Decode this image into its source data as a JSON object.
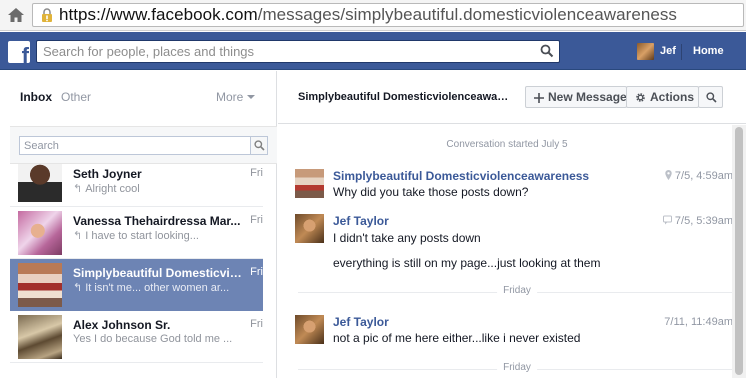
{
  "browser": {
    "url_prefix": "https://www.facebook.com",
    "url_path": "/messages/simplybeautiful.domesticviolenceawareness"
  },
  "bluebar": {
    "search_placeholder": "Search for people, places and things",
    "user_name": "Jef",
    "home_label": "Home"
  },
  "left": {
    "tab_inbox": "Inbox",
    "tab_other": "Other",
    "tab_more": "More",
    "search_placeholder": "Search",
    "threads": [
      {
        "name": "Seth Joyner",
        "time": "Fri",
        "snippet": "Alright cool",
        "replied": true,
        "selected": false,
        "avatar": "av-seth"
      },
      {
        "name": "Vanessa Thehairdressa Mar...",
        "time": "Fri",
        "snippet": "I have to start looking...",
        "replied": true,
        "selected": false,
        "avatar": "av-vanessa"
      },
      {
        "name": "Simplybeautiful Domesticvio...",
        "time": "Fri",
        "snippet": "It isn't me... other women ar...",
        "replied": true,
        "selected": true,
        "avatar": "av-simply"
      },
      {
        "name": "Alex Johnson Sr.",
        "time": "Fri",
        "snippet": "Yes I do because God told me ...",
        "replied": false,
        "selected": false,
        "avatar": "av-alex"
      }
    ]
  },
  "conversation": {
    "title": "Simplybeautiful Domesticviolenceawareness",
    "new_message_label": "New Message",
    "actions_label": "Actions",
    "started_label": "Conversation started July 5",
    "messages": [
      {
        "sender": "Simplybeautiful Domesticviolenceawareness",
        "time": "7/5, 4:59am",
        "time_icon": "location-icon",
        "lines": [
          "Why did you take those posts down?"
        ],
        "avatar": "av-simply-m"
      },
      {
        "sender": "Jef Taylor",
        "time": "7/5, 5:39am",
        "time_icon": "mobile-icon",
        "lines": [
          "I didn't take any posts down",
          "everything is still on my page...just looking at them"
        ],
        "avatar": "av-jef"
      },
      {
        "sender": "Jef Taylor",
        "time": "7/11, 11:49am",
        "time_icon": "",
        "lines": [
          "not a pic of me here either...like i never existed"
        ],
        "avatar": "av-jef"
      }
    ],
    "dividers": [
      "Friday",
      "Friday"
    ]
  }
}
